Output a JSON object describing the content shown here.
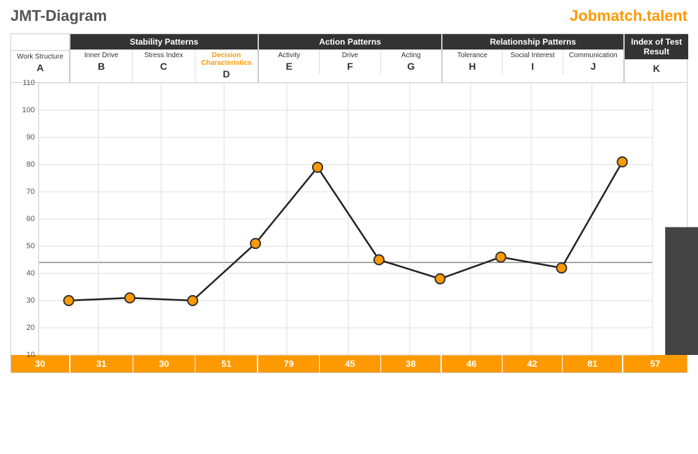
{
  "header": {
    "title": "JMT-Diagram",
    "brand_text": "Jobmatch.",
    "brand_accent": "talent"
  },
  "groups": [
    {
      "id": "A",
      "label": "",
      "columns": [
        {
          "id": "A",
          "subLabel": "Work Structure",
          "letter": "A",
          "value": 30,
          "data_y": 30
        }
      ]
    },
    {
      "id": "stability",
      "label": "Stability Patterns",
      "columns": [
        {
          "id": "B",
          "subLabel": "Inner Drive",
          "letter": "B",
          "value": 31,
          "data_y": 31
        },
        {
          "id": "C",
          "subLabel": "Stress Index",
          "letter": "C",
          "value": 30,
          "data_y": 30
        },
        {
          "id": "D",
          "subLabel": "Decision Characteristics",
          "letter": "D",
          "value": 51,
          "data_y": 51
        }
      ]
    },
    {
      "id": "action",
      "label": "Action Patterns",
      "columns": [
        {
          "id": "E",
          "subLabel": "Activity",
          "letter": "E",
          "value": 79,
          "data_y": 79
        },
        {
          "id": "F",
          "subLabel": "Drive",
          "letter": "F",
          "value": 45,
          "data_y": 45
        },
        {
          "id": "G",
          "subLabel": "Acting",
          "letter": "G",
          "value": 38,
          "data_y": 38
        }
      ]
    },
    {
      "id": "relationship",
      "label": "Relationship Patterns",
      "columns": [
        {
          "id": "H",
          "subLabel": "Tolerance",
          "letter": "H",
          "value": 46,
          "data_y": 46
        },
        {
          "id": "I",
          "subLabel": "Social Interest",
          "letter": "I",
          "value": 42,
          "data_y": 42
        },
        {
          "id": "J",
          "subLabel": "Communication",
          "letter": "J",
          "value": 81,
          "data_y": 81
        }
      ]
    },
    {
      "id": "K",
      "label": "Index of Test Result",
      "columns": [
        {
          "id": "K",
          "subLabel": "",
          "letter": "K",
          "value": 57,
          "data_y": 57
        }
      ]
    }
  ],
  "y_axis": {
    "min": 10,
    "max": 110,
    "step": 10,
    "labels": [
      110,
      100,
      90,
      80,
      70,
      60,
      50,
      40,
      30,
      20,
      10
    ]
  },
  "reference_line": 44,
  "chart": {
    "points": [
      {
        "col": "A",
        "value": 30
      },
      {
        "col": "B",
        "value": 31
      },
      {
        "col": "C",
        "value": 30
      },
      {
        "col": "D",
        "value": 51
      },
      {
        "col": "E",
        "value": 79
      },
      {
        "col": "F",
        "value": 45
      },
      {
        "col": "G",
        "value": 38
      },
      {
        "col": "H",
        "value": 46
      },
      {
        "col": "I",
        "value": 42
      },
      {
        "col": "J",
        "value": 81
      }
    ]
  }
}
